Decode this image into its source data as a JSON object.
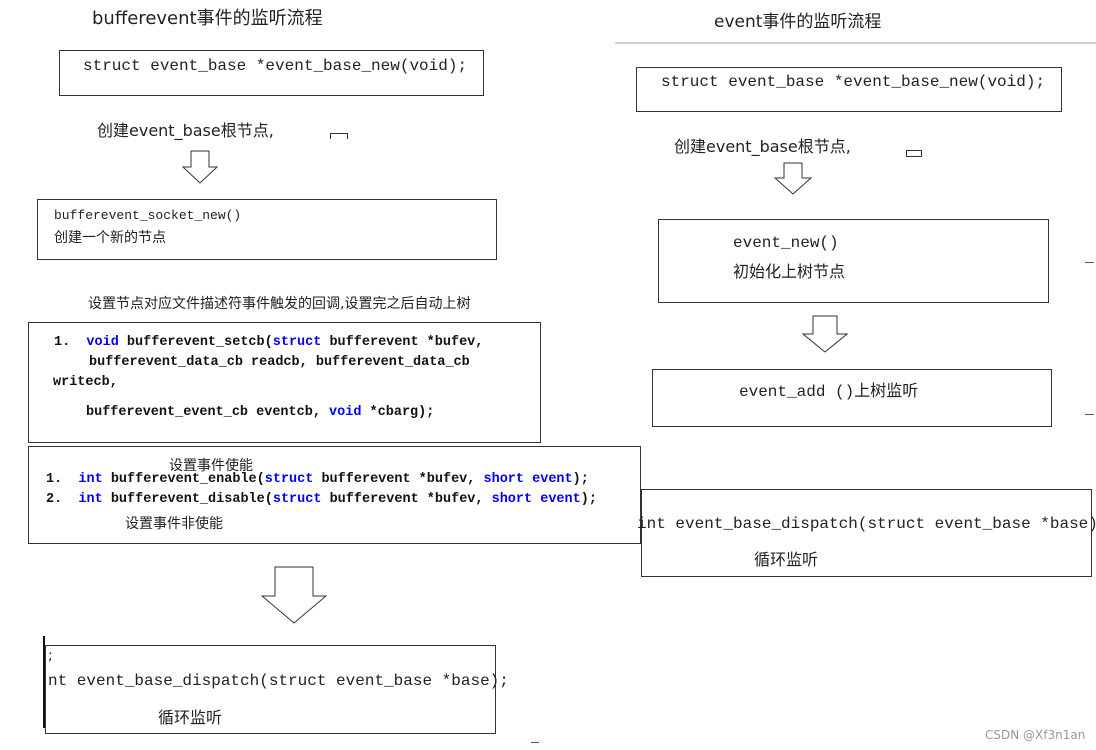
{
  "left": {
    "title": "bufferevent事件的监听流程",
    "step1_code": "struct event_base *event_base_new(void);",
    "step1_note": "创建event_base根节点,",
    "step2_code": "bufferevent_socket_new()",
    "step2_note": "创建一个新的节点",
    "step3_note": "设置节点对应文件描述符事件触发的回调,设置完之后自动上树",
    "setcb": {
      "num": "1.",
      "kw_void": "void",
      "fn": " bufferevent_setcb(",
      "kw_struct": "struct",
      "rest1": " bufferevent *bufev,",
      "line2": "bufferevent_data_cb readcb, bufferevent_data_cb",
      "line3": "writecb,",
      "line4a": "bufferevent_event_cb eventcb, ",
      "kw_void2": "void",
      "line4b": " *cbarg);"
    },
    "enable": {
      "title": "设置事件使能",
      "num1": "1.",
      "num2": "2.",
      "kw_int": "int",
      "enable_fn": " bufferevent_enable(",
      "disable_fn": " bufferevent_disable(",
      "kw_struct": "struct",
      "mid": " bufferevent *bufev, ",
      "kw_short": "short",
      "kw_event": "event",
      "end": ");",
      "disable_note": "设置事件非使能"
    },
    "dispatch_code": "nt event_base_dispatch(struct event_base *base);",
    "dispatch_semicolon": ";",
    "dispatch_note": "循环监听"
  },
  "right": {
    "title": "event事件的监听流程",
    "step1_code": "struct event_base *event_base_new(void);",
    "step1_note": "创建event_base根节点,",
    "step2_code": "event_new()",
    "step2_note": "初始化上树节点",
    "step3": "event_add ()上树监听",
    "dispatch_code": "int event_base_dispatch(struct event_base *base)",
    "dispatch_note": "循环监听"
  },
  "watermark": "CSDN @Xf3n1an",
  "colors": {
    "keyword": "#0000ee",
    "border": "#333333",
    "divider": "#c8d0dc"
  }
}
